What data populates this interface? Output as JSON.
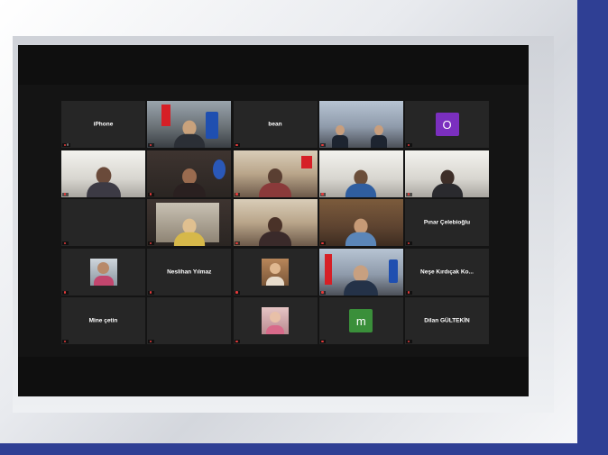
{
  "colors": {
    "background": "#2f3f94",
    "screen": "#141414",
    "tile": "#262626",
    "active_outline": "#c8d43a",
    "avatar_purple": "#7b2fbf",
    "avatar_green": "#3a8f3a",
    "mic_muted": "#e23b3b"
  },
  "tiles": [
    {
      "name": "iPhone",
      "label": "R",
      "type": "name"
    },
    {
      "name": "",
      "label": "",
      "type": "video",
      "scene": "room-flag"
    },
    {
      "name": "bean",
      "label": "",
      "type": "name"
    },
    {
      "name": "",
      "label": "",
      "type": "video",
      "scene": "office-two"
    },
    {
      "name": "",
      "label": "",
      "type": "avatar",
      "initial": "O",
      "color": "#7b2fbf"
    },
    {
      "name": "",
      "label": "",
      "type": "video",
      "scene": "light-woman"
    },
    {
      "name": "",
      "label": "",
      "type": "video",
      "scene": "dark-woman",
      "active": true
    },
    {
      "name": "",
      "label": "",
      "type": "video",
      "scene": "warm-woman"
    },
    {
      "name": "",
      "label": "",
      "type": "video",
      "scene": "mask-woman"
    },
    {
      "name": "",
      "label": "",
      "type": "video",
      "scene": "mask-man"
    },
    {
      "name": "",
      "label": "",
      "type": "blank"
    },
    {
      "name": "",
      "label": "",
      "type": "video",
      "scene": "blonde-woman"
    },
    {
      "name": "",
      "label": "",
      "type": "video",
      "scene": "warm-woman-2"
    },
    {
      "name": "",
      "label": "",
      "type": "video",
      "scene": "book-man"
    },
    {
      "name": "Pınar Çelebioğlu",
      "label": "",
      "type": "name"
    },
    {
      "name": "",
      "label": "",
      "type": "thumb",
      "scene": "thumb-person"
    },
    {
      "name": "Neslihan Yılmaz",
      "label": "",
      "type": "name"
    },
    {
      "name": "",
      "label": "",
      "type": "thumb",
      "scene": "thumb-woman"
    },
    {
      "name": "",
      "label": "",
      "type": "video",
      "scene": "flag-man"
    },
    {
      "name": "Neşe Kırdıçak Ko...",
      "label": "",
      "type": "name"
    },
    {
      "name": "Mine çetin",
      "label": "",
      "type": "name"
    },
    {
      "name": "",
      "label": "",
      "type": "blank"
    },
    {
      "name": "",
      "label": "",
      "type": "thumb",
      "scene": "thumb-child"
    },
    {
      "name": "",
      "label": "",
      "type": "avatar",
      "initial": "m",
      "color": "#3a8f3a"
    },
    {
      "name": "Dilan GÜLTEKİN",
      "label": "",
      "type": "name"
    }
  ]
}
